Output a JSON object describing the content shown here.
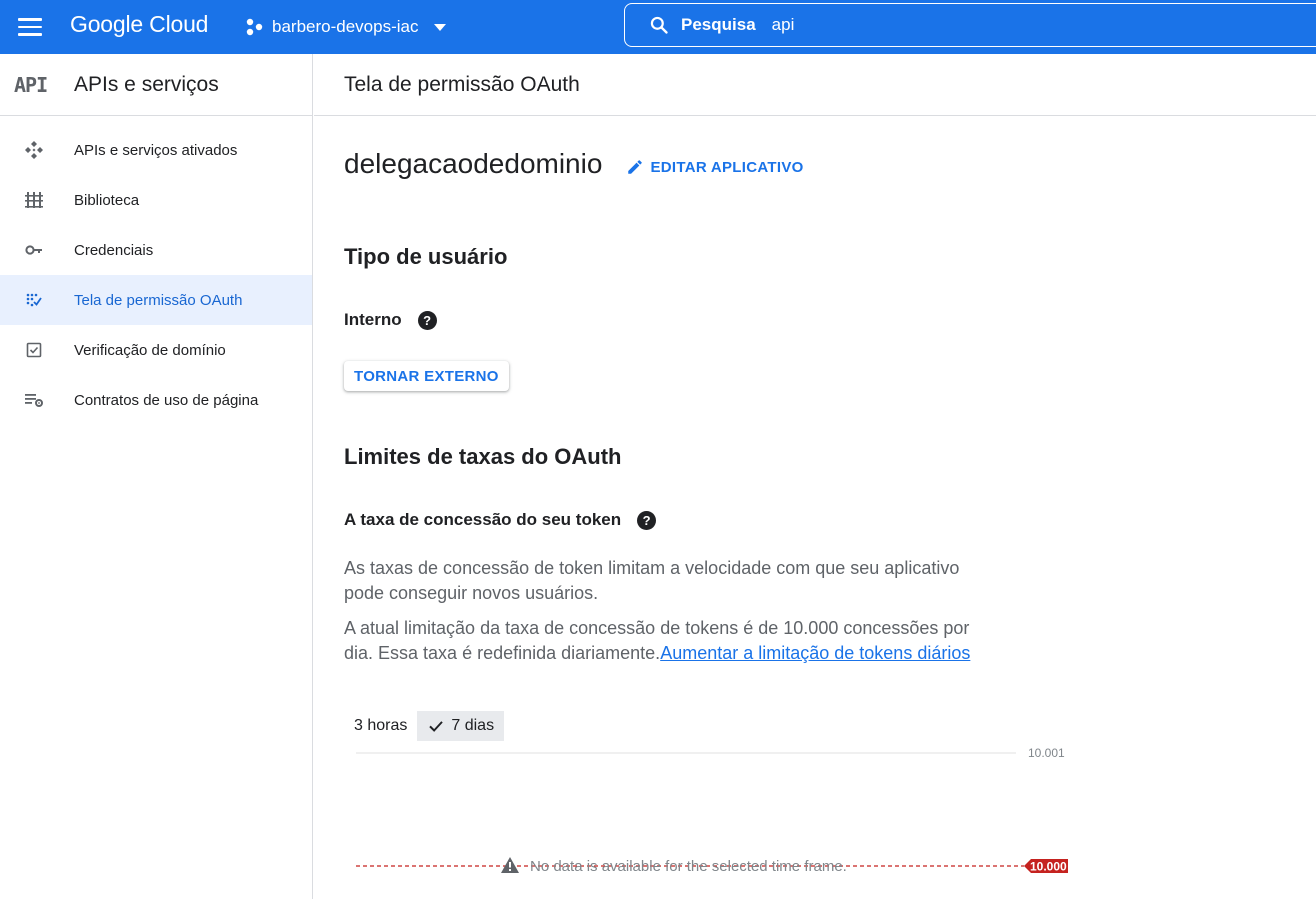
{
  "topbar": {
    "brand": "Google Cloud",
    "project_name": "barbero-devops-iac",
    "search_label": "Pesquisa",
    "search_value": "api"
  },
  "sidebar": {
    "logo": "API",
    "title": "APIs e serviços",
    "items": [
      {
        "label": "APIs e serviços ativados",
        "icon": "apis-icon",
        "active": false
      },
      {
        "label": "Biblioteca",
        "icon": "library-icon",
        "active": false
      },
      {
        "label": "Credenciais",
        "icon": "key-icon",
        "active": false
      },
      {
        "label": "Tela de permissão OAuth",
        "icon": "oauth-consent-icon",
        "active": true
      },
      {
        "label": "Verificação de domínio",
        "icon": "checkbox-icon",
        "active": false
      },
      {
        "label": "Contratos de uso de página",
        "icon": "settings-list-icon",
        "active": false
      }
    ]
  },
  "main": {
    "page_title": "Tela de permissão OAuth",
    "app_name": "delegacaodedominio",
    "edit_label": "EDITAR APLICATIVO",
    "user_type_heading": "Tipo de usuário",
    "user_type_value": "Interno",
    "make_external_label": "TORNAR EXTERNO",
    "rate_limits_heading": "Limites de taxas do OAuth",
    "token_rate_heading": "A taxa de concessão do seu token",
    "para1": "As taxas de concessão de token limitam a velocidade com que seu aplicativo pode conseguir novos usuários.",
    "para2": "A atual limitação da taxa de concessão de tokens é de 10.000 concessões por dia. Essa taxa é redefinida diariamente.",
    "para2_link": "Aumentar a limitação de tokens diários",
    "range_options": [
      "3 horas",
      "7 dias"
    ],
    "range_selected": "7 dias"
  },
  "chart_data": {
    "type": "line",
    "y_top_label": "10.001",
    "threshold_label": "10.000",
    "threshold_value": 10000,
    "empty_message": "No data is available for the selected time frame.",
    "series": [],
    "colors": {
      "threshold": "#c5221f",
      "grid": "#e0e0e0"
    }
  },
  "colors": {
    "accent": "#1a73e8",
    "topbar": "#1a73e8",
    "active_bg": "#e8f0fe"
  }
}
